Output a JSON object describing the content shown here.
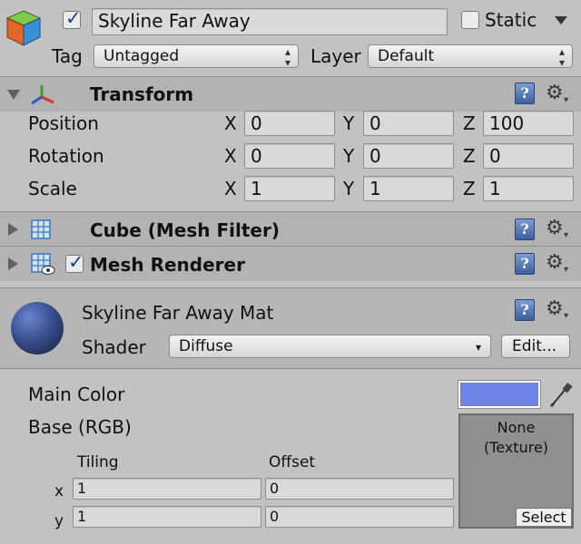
{
  "header": {
    "object_name": "Skyline Far Away",
    "active_checked": true,
    "static_label": "Static",
    "static_checked": false,
    "tag_label": "Tag",
    "tag_value": "Untagged",
    "layer_label": "Layer",
    "layer_value": "Default"
  },
  "transform": {
    "title": "Transform",
    "rows": [
      {
        "label": "Position",
        "x": "0",
        "y": "0",
        "z": "100"
      },
      {
        "label": "Rotation",
        "x": "0",
        "y": "0",
        "z": "0"
      },
      {
        "label": "Scale",
        "x": "1",
        "y": "1",
        "z": "1"
      }
    ],
    "axis_x": "X",
    "axis_y": "Y",
    "axis_z": "Z"
  },
  "mesh_filter": {
    "title": "Cube (Mesh Filter)"
  },
  "mesh_renderer": {
    "title": "Mesh Renderer",
    "enabled": true
  },
  "material": {
    "name": "Skyline Far Away Mat",
    "shader_label": "Shader",
    "shader_value": "Diffuse",
    "edit_label": "Edit...",
    "main_color_label": "Main Color",
    "main_color": "#6b84e6",
    "base_label": "Base (RGB)",
    "tiling_label": "Tiling",
    "offset_label": "Offset",
    "x_label": "x",
    "y_label": "y",
    "tiling_x": "1",
    "tiling_y": "1",
    "offset_x": "0",
    "offset_y": "0",
    "texture_none": "None",
    "texture_type": "(Texture)",
    "select_label": "Select"
  },
  "icons": {
    "help": "?",
    "gear": "⚙",
    "gear_caret": "▾",
    "eyedropper": "✎"
  }
}
